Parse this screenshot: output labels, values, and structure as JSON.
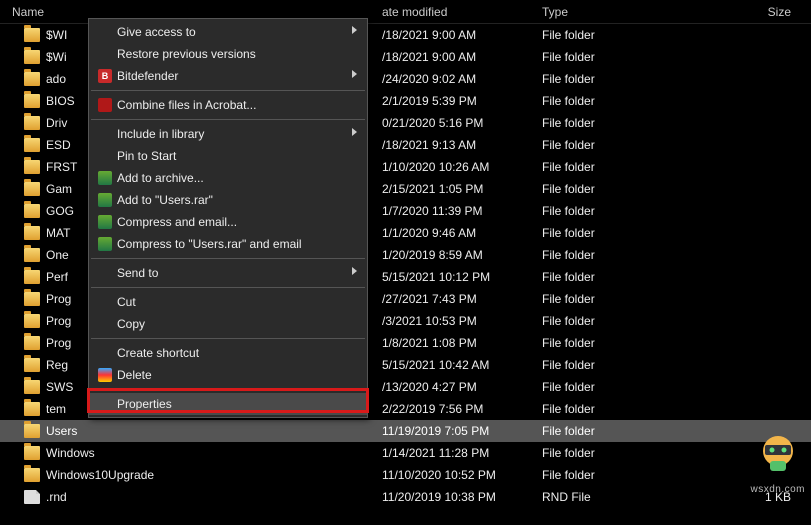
{
  "columns": {
    "name": "Name",
    "date": "ate modified",
    "type": "Type",
    "size": "Size"
  },
  "files": [
    {
      "name": "$WI",
      "date": "/18/2021 9:00 AM",
      "type": "File folder",
      "size": "",
      "icon": "folder"
    },
    {
      "name": "$Wi",
      "date": "/18/2021 9:00 AM",
      "type": "File folder",
      "size": "",
      "icon": "folder"
    },
    {
      "name": "ado",
      "date": "/24/2020 9:02 AM",
      "type": "File folder",
      "size": "",
      "icon": "folder"
    },
    {
      "name": "BIOS",
      "date": "2/1/2019 5:39 PM",
      "type": "File folder",
      "size": "",
      "icon": "folder"
    },
    {
      "name": "Driv",
      "date": "0/21/2020 5:16 PM",
      "type": "File folder",
      "size": "",
      "icon": "folder"
    },
    {
      "name": "ESD",
      "date": "/18/2021 9:13 AM",
      "type": "File folder",
      "size": "",
      "icon": "folder"
    },
    {
      "name": "FRST",
      "date": "1/10/2020 10:26 AM",
      "type": "File folder",
      "size": "",
      "icon": "folder"
    },
    {
      "name": "Gam",
      "date": "2/15/2021 1:05 PM",
      "type": "File folder",
      "size": "",
      "icon": "folder"
    },
    {
      "name": "GOG",
      "date": "1/7/2020 11:39 PM",
      "type": "File folder",
      "size": "",
      "icon": "folder"
    },
    {
      "name": "MAT",
      "date": "1/1/2020 9:46 AM",
      "type": "File folder",
      "size": "",
      "icon": "folder"
    },
    {
      "name": "One",
      "date": "1/20/2019 8:59 AM",
      "type": "File folder",
      "size": "",
      "icon": "folder"
    },
    {
      "name": "Perf",
      "date": "5/15/2021 10:12 PM",
      "type": "File folder",
      "size": "",
      "icon": "folder"
    },
    {
      "name": "Prog",
      "date": "/27/2021 7:43 PM",
      "type": "File folder",
      "size": "",
      "icon": "folder"
    },
    {
      "name": "Prog",
      "date": "/3/2021 10:53 PM",
      "type": "File folder",
      "size": "",
      "icon": "folder"
    },
    {
      "name": "Prog",
      "date": "1/8/2021 1:08 PM",
      "type": "File folder",
      "size": "",
      "icon": "folder"
    },
    {
      "name": "Reg",
      "date": "5/15/2021 10:42 AM",
      "type": "File folder",
      "size": "",
      "icon": "folder"
    },
    {
      "name": "SWS",
      "date": "/13/2020 4:27 PM",
      "type": "File folder",
      "size": "",
      "icon": "folder"
    },
    {
      "name": "tem",
      "date": "2/22/2019 7:56 PM",
      "type": "File folder",
      "size": "",
      "icon": "folder"
    },
    {
      "name": "Users",
      "date": "11/19/2019 7:05 PM",
      "type": "File folder",
      "size": "",
      "icon": "folder",
      "selected": true
    },
    {
      "name": "Windows",
      "date": "1/14/2021 11:28 PM",
      "type": "File folder",
      "size": "",
      "icon": "folder"
    },
    {
      "name": "Windows10Upgrade",
      "date": "11/10/2020 10:52 PM",
      "type": "File folder",
      "size": "",
      "icon": "folder"
    },
    {
      "name": ".rnd",
      "date": "11/20/2019 10:38 PM",
      "type": "RND File",
      "size": "1 KB",
      "icon": "file"
    }
  ],
  "context_menu": [
    {
      "label": "Give access to",
      "submenu": true
    },
    {
      "label": "Restore previous versions"
    },
    {
      "label": "Bitdefender",
      "icon": "bit",
      "submenu": true
    },
    {
      "sep": true
    },
    {
      "label": "Combine files in Acrobat...",
      "icon": "acro"
    },
    {
      "sep": true
    },
    {
      "label": "Include in library",
      "submenu": true
    },
    {
      "label": "Pin to Start"
    },
    {
      "label": "Add to archive...",
      "icon": "rar"
    },
    {
      "label": "Add to \"Users.rar\"",
      "icon": "rar"
    },
    {
      "label": "Compress and email...",
      "icon": "rar"
    },
    {
      "label": "Compress to \"Users.rar\" and email",
      "icon": "rar"
    },
    {
      "sep": true
    },
    {
      "label": "Send to",
      "submenu": true
    },
    {
      "sep": true
    },
    {
      "label": "Cut"
    },
    {
      "label": "Copy"
    },
    {
      "sep": true
    },
    {
      "label": "Create shortcut"
    },
    {
      "label": "Delete",
      "icon": "shield"
    },
    {
      "sep": true
    },
    {
      "label": "Properties",
      "highlight": true
    }
  ],
  "watermark": "wsxdn.com"
}
